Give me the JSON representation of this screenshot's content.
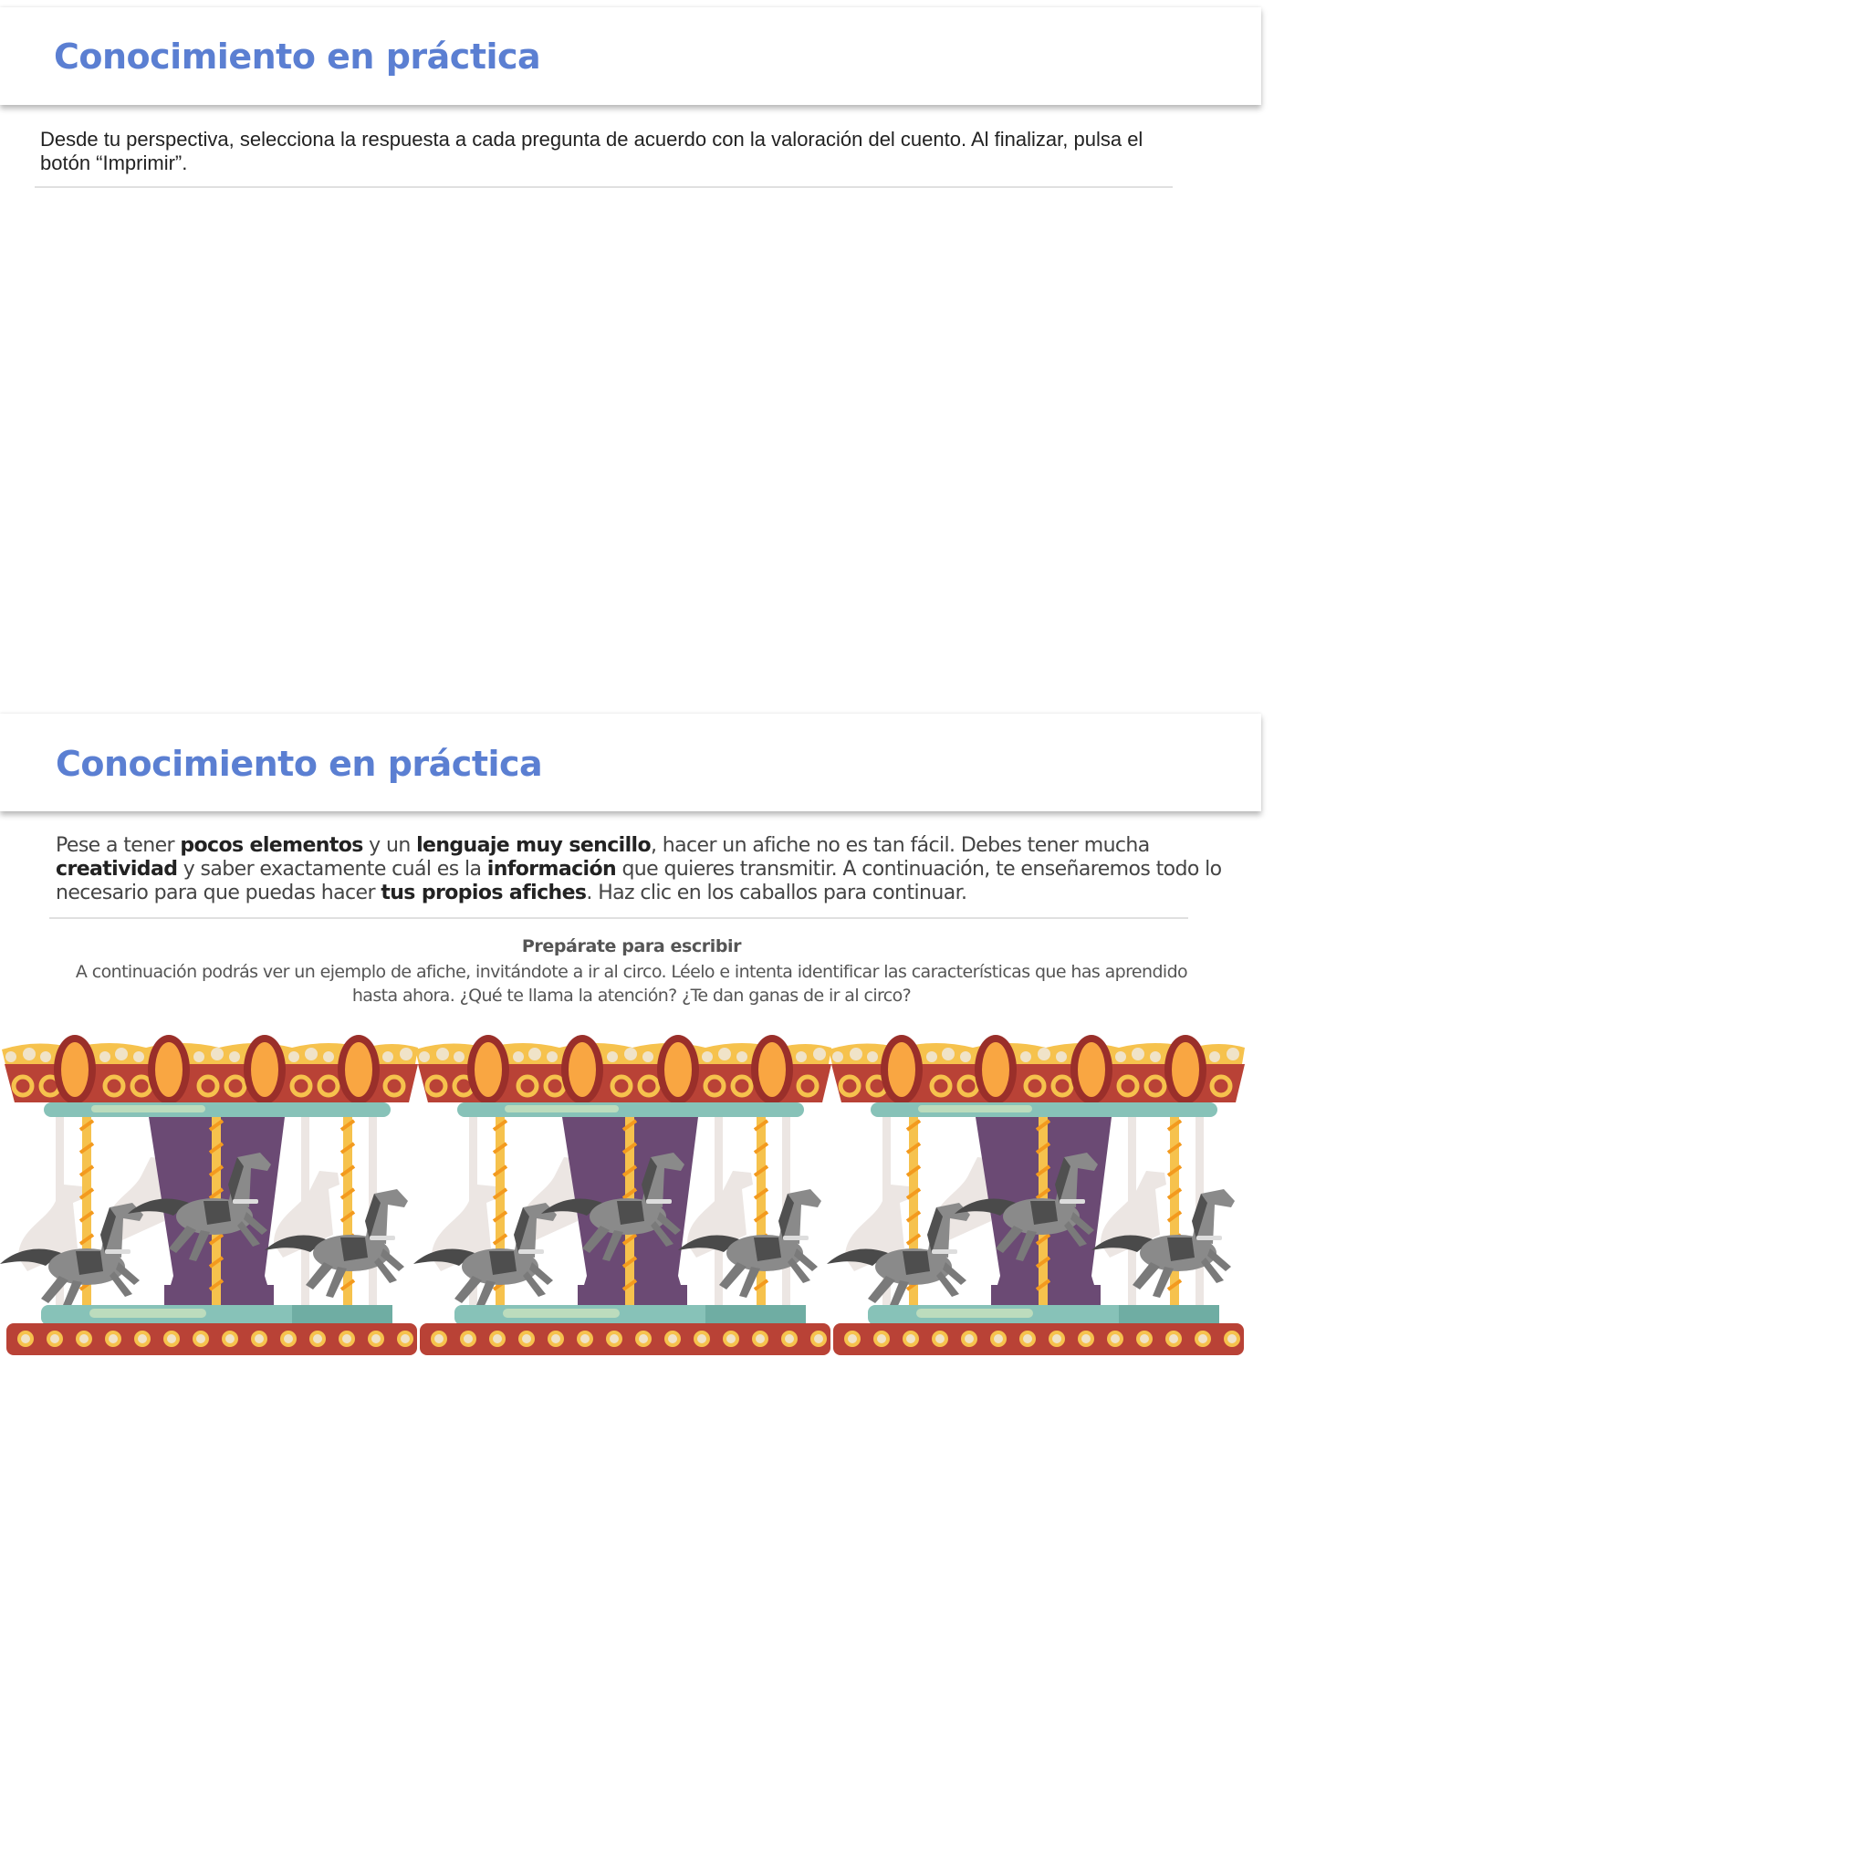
{
  "section1": {
    "title": "Conocimiento en práctica",
    "instructions": "Desde tu perspectiva, selecciona la respuesta a cada pregunta de acuerdo con la valoración del cuento. Al finalizar, pulsa el botón “Imprimir”."
  },
  "section2": {
    "title": "Conocimiento en práctica",
    "paragraph": [
      {
        "text": "Pese a tener ",
        "bold": false
      },
      {
        "text": "pocos elementos",
        "bold": true
      },
      {
        "text": " y un ",
        "bold": false
      },
      {
        "text": "lenguaje muy sencillo",
        "bold": true
      },
      {
        "text": ", hacer un afiche no es tan fácil. Debes tener mucha ",
        "bold": false
      },
      {
        "text": "creatividad",
        "bold": true
      },
      {
        "text": " y saber exactamente cuál es la ",
        "bold": false
      },
      {
        "text": "información",
        "bold": true
      },
      {
        "text": " que quieres transmitir. A continuación, te enseñaremos todo lo necesario para que puedas hacer ",
        "bold": false
      },
      {
        "text": "tus propios afiches",
        "bold": true
      },
      {
        "text": ". Haz clic en los caballos para continuar.",
        "bold": false
      }
    ],
    "subheading": "Prepárate para escribir",
    "subtext": "A continuación podrás ver un ejemplo de afiche, invitándote a ir al circo. Léelo e intenta identificar las características que has aprendido hasta ahora. ¿Qué te llama la atención? ¿Te dan ganas de ir al circo?"
  },
  "carousel": {
    "icon": "carousel-horses-image",
    "units": 3,
    "colors": {
      "red": "#b94236",
      "dark_red": "#9a2f2a",
      "yellow": "#f6c24d",
      "orange": "#f9a642",
      "teal": "#87c2b8",
      "purple": "#6b4a74",
      "horse": "#8a8a8a"
    }
  }
}
